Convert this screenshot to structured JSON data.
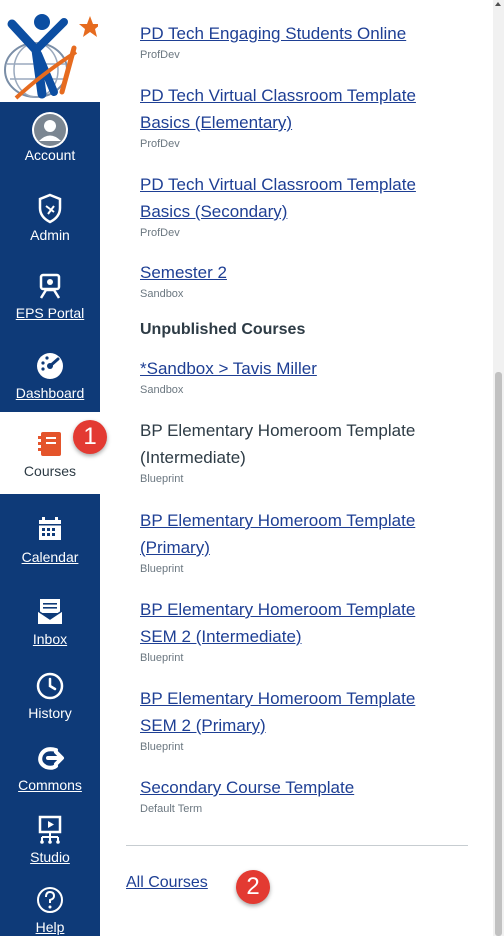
{
  "nav": {
    "items": [
      {
        "label": "Account",
        "icon": "account-icon"
      },
      {
        "label": "Admin",
        "icon": "shield-icon"
      },
      {
        "label": "EPS Portal",
        "icon": "portal-icon"
      },
      {
        "label": "Dashboard",
        "icon": "dashboard-icon"
      },
      {
        "label": "Courses",
        "icon": "courses-icon"
      },
      {
        "label": "Calendar",
        "icon": "calendar-icon"
      },
      {
        "label": "Inbox",
        "icon": "inbox-icon"
      },
      {
        "label": "History",
        "icon": "history-icon"
      },
      {
        "label": "Commons",
        "icon": "commons-icon"
      },
      {
        "label": "Studio",
        "icon": "studio-icon"
      },
      {
        "label": "Help",
        "icon": "help-icon"
      }
    ],
    "active": "Courses"
  },
  "badges": {
    "one": "1",
    "two": "2"
  },
  "courses": {
    "published": [
      {
        "title": "PD Tech Engaging Students Online",
        "term": "ProfDev"
      },
      {
        "title": "PD Tech Virtual Classroom Template Basics (Elementary)",
        "term": "ProfDev"
      },
      {
        "title": "PD Tech Virtual Classroom Template Basics (Secondary)",
        "term": "ProfDev"
      },
      {
        "title": "Semester 2",
        "term": "Sandbox"
      }
    ],
    "unpublished_heading": "Unpublished Courses",
    "unpublished": [
      {
        "title": "*Sandbox > Tavis Miller",
        "term": "Sandbox"
      },
      {
        "title": "BP Elementary Homeroom Template (Intermediate)",
        "term": "Blueprint"
      },
      {
        "title": "BP Elementary Homeroom Template (Primary)",
        "term": "Blueprint"
      },
      {
        "title": "BP Elementary Homeroom Template SEM 2 (Intermediate)",
        "term": "Blueprint"
      },
      {
        "title": "BP Elementary Homeroom Template SEM 2 (Primary)",
        "term": "Blueprint"
      },
      {
        "title": "Secondary Course Template",
        "term": "Default Term"
      }
    ],
    "all_courses": "All Courses"
  },
  "colors": {
    "nav_bg": "#0e3a78",
    "link": "#1e3f94",
    "badge": "#e33a32"
  }
}
